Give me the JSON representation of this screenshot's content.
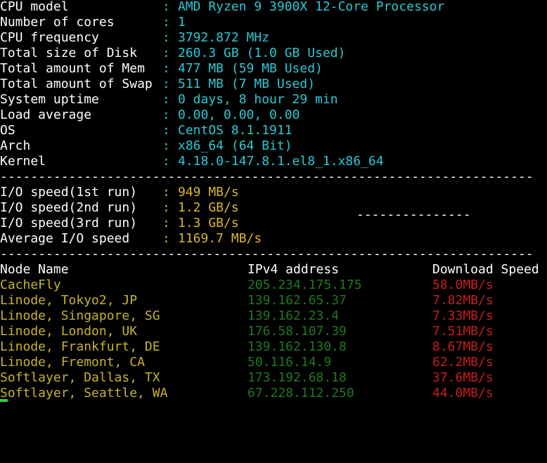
{
  "system_info": [
    {
      "label": "CPU model",
      "value": "AMD Ryzen 9 3900X 12-Core Processor"
    },
    {
      "label": "Number of cores",
      "value": "1"
    },
    {
      "label": "CPU frequency",
      "value": "3792.872 MHz"
    },
    {
      "label": "Total size of Disk",
      "value": "260.3 GB (1.0 GB Used)"
    },
    {
      "label": "Total amount of Mem",
      "value": "477 MB (59 MB Used)"
    },
    {
      "label": "Total amount of Swap",
      "value": "511 MB (7 MB Used)"
    },
    {
      "label": "System uptime",
      "value": "0 days, 8 hour 29 min"
    },
    {
      "label": "Load average",
      "value": "0.00, 0.00, 0.00"
    },
    {
      "label": "OS",
      "value": "CentOS 8.1.1911"
    },
    {
      "label": "Arch",
      "value": "x86_64 (64 Bit)"
    },
    {
      "label": "Kernel",
      "value": "4.18.0-147.8.1.el8_1.x86_64"
    }
  ],
  "separator": "----------------------------------------------------------------------",
  "io_speed": [
    {
      "label": "I/O speed(1st run)",
      "value": "949 MB/s"
    },
    {
      "label": "I/O speed(2nd run)",
      "value": "1.2 GB/s"
    },
    {
      "label": "I/O speed(3rd run)",
      "value": "1.3 GB/s"
    },
    {
      "label": "Average I/O speed",
      "value": "1169.7 MB/s"
    }
  ],
  "stray_text": "---------------",
  "colon": ":",
  "network": {
    "headers": {
      "node": "Node Name",
      "ip": "IPv4 address",
      "speed": "Download Speed"
    },
    "rows": [
      {
        "node": "CacheFly",
        "ip": "205.234.175.175",
        "speed": "58.0MB/s"
      },
      {
        "node": "Linode, Tokyo2, JP",
        "ip": "139.162.65.37",
        "speed": "7.82MB/s"
      },
      {
        "node": "Linode, Singapore, SG",
        "ip": "139.162.23.4",
        "speed": "7.33MB/s"
      },
      {
        "node": "Linode, London, UK",
        "ip": "176.58.107.39",
        "speed": "7.51MB/s"
      },
      {
        "node": "Linode, Frankfurt, DE",
        "ip": "139.162.130.8",
        "speed": "8.67MB/s"
      },
      {
        "node": "Linode, Fremont, CA",
        "ip": "50.116.14.9",
        "speed": "62.2MB/s"
      },
      {
        "node": "Softlayer, Dallas, TX",
        "ip": "173.192.68.18",
        "speed": "37.6MB/s"
      },
      {
        "node": "Softlayer, Seattle, WA",
        "ip": "67.228.112.250",
        "speed": "44.0MB/s"
      }
    ]
  },
  "colors": {
    "background": "#000000",
    "system_value": "#2cc9d4",
    "io_value": "#d9b52f",
    "node_name": "#c8b42a",
    "ip": "#1e7a1e",
    "speed": "#c81d1d",
    "cursor": "#32d232"
  }
}
